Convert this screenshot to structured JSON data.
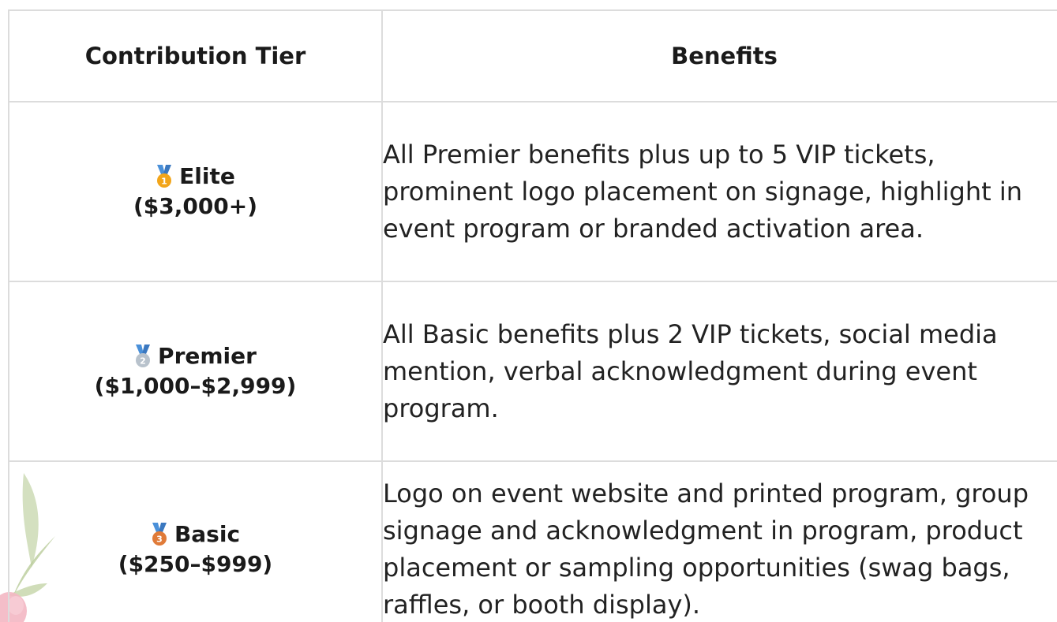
{
  "table": {
    "headers": {
      "tier": "Contribution Tier",
      "benefits": "Benefits"
    },
    "rows": [
      {
        "medal_icon": "gold-medal-icon",
        "medal_number": "1",
        "tier_name": "Elite",
        "tier_amount": "($3,000+)",
        "benefits": "All Premier benefits plus up to 5 VIP tickets, prominent logo placement on signage, highlight in event program or branded activation area."
      },
      {
        "medal_icon": "silver-medal-icon",
        "medal_number": "2",
        "tier_name": "Premier",
        "tier_amount": "($1,000–$2,999)",
        "benefits": "All Basic benefits plus 2 VIP tickets, social media mention, verbal acknowledgment during event program."
      },
      {
        "medal_icon": "bronze-medal-icon",
        "medal_number": "3",
        "tier_name": "Basic",
        "tier_amount": "($250–$999)",
        "benefits": "Logo on event website and printed program, group signage and acknowledgment in program, product placement or sampling opportunities (swag bags, raffles, or booth display)."
      }
    ]
  },
  "colors": {
    "border": "#dcdcdc",
    "ribbon": "#4a90d9",
    "gold": "#f2a51a",
    "silver": "#b8c2cc",
    "bronze": "#e07b39"
  }
}
